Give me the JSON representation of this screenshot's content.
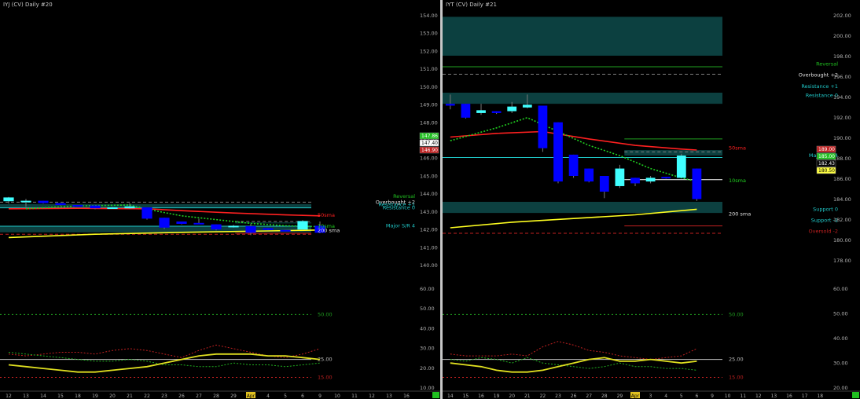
{
  "colors": {
    "background": "#000000",
    "bull_candle": "#40ffff",
    "bear_candle": "#0000ff",
    "zone_fill": "#0e4b4b",
    "sma50": "#ff2020",
    "sma10": "#20d020",
    "sma200": "#ffff20",
    "adx_red": "#c02020",
    "adx_green": "#20b020",
    "adx_yellow": "#e0e020",
    "reversal_line": "#20a020",
    "support_line": "#20c8c8",
    "price_label": "#ffd040"
  },
  "chart_data": [
    {
      "type": "candlestick",
      "id": "left",
      "title": "IYJ (CV) Daily #20",
      "ylim": [
        140.2,
        194.2
      ],
      "x_labels": [
        "12",
        "13",
        "14",
        "15",
        "18",
        "19",
        "20",
        "21",
        "22",
        "23",
        "26",
        "27",
        "28",
        "29",
        "Apr",
        "4",
        "5",
        "6",
        "9",
        "10",
        "11",
        "12",
        "13",
        "16"
      ],
      "candles": [
        {
          "o": 153.5,
          "h": 154.4,
          "l": 153.0,
          "c": 154.3
        },
        {
          "o": 153.5,
          "h": 154.0,
          "l": 152.3,
          "c": 153.6
        },
        {
          "o": 153.6,
          "h": 153.6,
          "l": 153.0,
          "c": 153.1
        },
        {
          "o": 153.1,
          "h": 153.1,
          "l": 152.6,
          "c": 152.7
        },
        {
          "o": 152.7,
          "h": 152.7,
          "l": 152.4,
          "c": 152.5
        },
        {
          "o": 152.6,
          "h": 152.6,
          "l": 151.8,
          "c": 152.0
        },
        {
          "o": 152.2,
          "h": 152.3,
          "l": 152.1,
          "c": 152.2
        },
        {
          "o": 152.0,
          "h": 153.1,
          "l": 151.9,
          "c": 152.4
        },
        {
          "o": 152.2,
          "h": 152.2,
          "l": 149.6,
          "c": 149.8
        },
        {
          "o": 150.0,
          "h": 150.0,
          "l": 147.6,
          "c": 147.9
        },
        {
          "o": 149.2,
          "h": 149.2,
          "l": 148.6,
          "c": 148.7
        },
        {
          "o": 148.9,
          "h": 149.8,
          "l": 148.7,
          "c": 148.7
        },
        {
          "o": 148.6,
          "h": 148.6,
          "l": 147.3,
          "c": 147.5
        },
        {
          "o": 148.1,
          "h": 148.5,
          "l": 147.9,
          "c": 148.3
        },
        {
          "o": 148.2,
          "h": 148.7,
          "l": 146.3,
          "c": 146.8
        },
        {
          "o": 147.8,
          "h": 147.8,
          "l": 147.3,
          "c": 147.4
        },
        {
          "o": 147.4,
          "h": 147.4,
          "l": 147.1,
          "c": 147.2
        },
        {
          "o": 147.5,
          "h": 149.5,
          "l": 147.4,
          "c": 149.3
        },
        {
          "o": 148.3,
          "h": 149.2,
          "l": 146.7,
          "c": 146.8
        }
      ],
      "sma50": [
        {
          "i": 0,
          "v": 151.9
        },
        {
          "i": 4,
          "v": 152.0
        },
        {
          "i": 8,
          "v": 151.9
        },
        {
          "i": 10,
          "v": 151.5
        },
        {
          "i": 13,
          "v": 151.0
        },
        {
          "i": 16,
          "v": 150.6
        },
        {
          "i": 18,
          "v": 150.4
        }
      ],
      "sma10": [
        {
          "i": 1,
          "v": 151.9
        },
        {
          "i": 4,
          "v": 152.5
        },
        {
          "i": 7,
          "v": 152.7
        },
        {
          "i": 8,
          "v": 151.8
        },
        {
          "i": 10,
          "v": 150.4
        },
        {
          "i": 12,
          "v": 149.6
        },
        {
          "i": 14,
          "v": 148.8
        },
        {
          "i": 16,
          "v": 148.3
        },
        {
          "i": 18,
          "v": 148.1
        }
      ],
      "sma200": [
        {
          "i": 0,
          "v": 145.8
        },
        {
          "i": 5,
          "v": 146.5
        },
        {
          "i": 10,
          "v": 146.9
        },
        {
          "i": 15,
          "v": 147.2
        },
        {
          "i": 18,
          "v": 147.4
        }
      ],
      "zones": [
        {
          "top": 152.9,
          "bottom": 152.1
        },
        {
          "top": 148.2,
          "bottom": 146.9
        },
        {
          "top": 149.0,
          "bottom": 148.8,
          "x_from": 13.1
        }
      ],
      "h_lines": [
        {
          "value": 153.3,
          "style": "dashed",
          "color": "#808080"
        },
        {
          "value": 148.2,
          "style": "solid",
          "color": "#20c8c8"
        },
        {
          "value": 149.2,
          "style": "dashed",
          "color": "#808080",
          "x_from": 13.1
        },
        {
          "value": 152.1,
          "style": "solid",
          "color": "#20c8c8"
        },
        {
          "value": 146.5,
          "style": "dashed",
          "color": "#c02020"
        },
        {
          "value": 146.7,
          "style": "solid",
          "color": "#c02020",
          "x_from": 13.1
        }
      ],
      "line_labels": [
        {
          "text": "Reversal",
          "value": 154.5,
          "color": "#20c020"
        },
        {
          "text": "Overbought +2",
          "value": 153.3,
          "color": "#e0e0e0"
        },
        {
          "text": "Resistance +1",
          "value": 152.8,
          "color": "#20c8c8"
        },
        {
          "text": "Resistance 0",
          "value": 152.1,
          "color": "#20c8c8"
        },
        {
          "text": "Major S/R 4",
          "value": 148.3,
          "color": "#20c8c8"
        }
      ],
      "ma_labels": [
        {
          "text": "50sma",
          "value": 150.5,
          "color": "#ff2020"
        },
        {
          "text": "10sma",
          "value": 148.2,
          "color": "#20d020"
        },
        {
          "text": "200 sma",
          "value": 147.3,
          "color": "#e0e0e0"
        }
      ],
      "y_ticks": [
        "154.00",
        "153.00",
        "152.00",
        "151.00",
        "150.00",
        "149.00",
        "148.00",
        "147.00",
        "146.00",
        "145.00",
        "144.00",
        "143.00",
        "142.00",
        "141.00",
        "140.00",
        "60.00",
        "50.00",
        "40.00",
        "30.00",
        "20.00",
        "10.00"
      ],
      "price_tags": [
        {
          "text": "147.86",
          "bg": "#20c020"
        },
        {
          "text": "147.40",
          "bg": "#ffffff"
        },
        {
          "text": "146.90",
          "bg": "#c02020"
        }
      ],
      "adx": {
        "ylim": [
          10,
          65
        ],
        "levels": [
          {
            "text": "50.00",
            "value": 50
          },
          {
            "text": "25.00",
            "value": 25
          },
          {
            "text": "15.00",
            "value": 15
          }
        ],
        "red": [
          28,
          27,
          28,
          29,
          29,
          28,
          30,
          31,
          30,
          28,
          26,
          30,
          33,
          31,
          29,
          27,
          26,
          28,
          31
        ],
        "green": [
          29,
          28,
          27,
          26,
          25,
          24,
          24,
          25,
          24,
          22,
          22,
          21,
          21,
          23,
          22,
          22,
          21,
          22,
          23
        ],
        "yellow": [
          22,
          21,
          20,
          19,
          18,
          18,
          19,
          20,
          21,
          23,
          25,
          27,
          28,
          28,
          28,
          27,
          27,
          26,
          25
        ]
      }
    },
    {
      "type": "candlestick",
      "id": "right",
      "title": "IYT (CV) Daily #21",
      "ylim": [
        176.8,
        203.8
      ],
      "x_labels": [
        "14",
        "15",
        "16",
        "19",
        "20",
        "21",
        "22",
        "23",
        "26",
        "27",
        "28",
        "29",
        "Apr",
        "3",
        "4",
        "5",
        "6",
        "9",
        "10",
        "11",
        "12",
        "13",
        "16",
        "17",
        "18"
      ],
      "candles": [
        {
          "o": 193.6,
          "h": 194.6,
          "l": 193.0,
          "c": 193.4
        },
        {
          "o": 193.6,
          "h": 193.6,
          "l": 192.0,
          "c": 192.1
        },
        {
          "o": 192.6,
          "h": 193.6,
          "l": 192.4,
          "c": 192.9
        },
        {
          "o": 192.8,
          "h": 192.8,
          "l": 192.5,
          "c": 192.6
        },
        {
          "o": 192.8,
          "h": 193.8,
          "l": 192.6,
          "c": 193.3
        },
        {
          "o": 193.2,
          "h": 194.6,
          "l": 193.1,
          "c": 193.5
        },
        {
          "o": 193.4,
          "h": 193.4,
          "l": 188.4,
          "c": 188.8
        },
        {
          "o": 191.6,
          "h": 191.6,
          "l": 185.0,
          "c": 185.2
        },
        {
          "o": 188.1,
          "h": 188.1,
          "l": 185.6,
          "c": 185.8
        },
        {
          "o": 186.6,
          "h": 186.6,
          "l": 185.1,
          "c": 185.2
        },
        {
          "o": 185.8,
          "h": 185.8,
          "l": 183.4,
          "c": 184.1
        },
        {
          "o": 184.7,
          "h": 187.0,
          "l": 184.5,
          "c": 186.6
        },
        {
          "o": 185.6,
          "h": 185.6,
          "l": 184.7,
          "c": 185.0
        },
        {
          "o": 185.2,
          "h": 185.8,
          "l": 185.0,
          "c": 185.6
        },
        {
          "o": 185.7,
          "h": 185.7,
          "l": 185.5,
          "c": 185.6
        },
        {
          "o": 185.6,
          "h": 188.2,
          "l": 185.6,
          "c": 188.0
        },
        {
          "o": 186.6,
          "h": 186.6,
          "l": 183.1,
          "c": 183.3
        }
      ],
      "sma50": [
        {
          "i": 0,
          "v": 190.0
        },
        {
          "i": 3,
          "v": 190.4
        },
        {
          "i": 6,
          "v": 190.6
        },
        {
          "i": 9,
          "v": 189.8
        },
        {
          "i": 12,
          "v": 189.1
        },
        {
          "i": 15,
          "v": 188.7
        },
        {
          "i": 16,
          "v": 188.6
        }
      ],
      "sma10": [
        {
          "i": 0,
          "v": 189.6
        },
        {
          "i": 3,
          "v": 191.0
        },
        {
          "i": 5,
          "v": 192.1
        },
        {
          "i": 7,
          "v": 190.6
        },
        {
          "i": 9,
          "v": 189.1
        },
        {
          "i": 11,
          "v": 188.0
        },
        {
          "i": 13,
          "v": 186.6
        },
        {
          "i": 15,
          "v": 185.6
        },
        {
          "i": 16,
          "v": 185.2
        }
      ],
      "sma200": [
        {
          "i": 0,
          "v": 180.2
        },
        {
          "i": 4,
          "v": 180.8
        },
        {
          "i": 8,
          "v": 181.2
        },
        {
          "i": 12,
          "v": 181.6
        },
        {
          "i": 16,
          "v": 182.2
        }
      ],
      "zones": [
        {
          "top": 203.0,
          "bottom": 198.8
        },
        {
          "top": 194.8,
          "bottom": 193.6
        },
        {
          "top": 188.6,
          "bottom": 188.0,
          "x_from": 11.3
        },
        {
          "top": 183.0,
          "bottom": 181.8
        }
      ],
      "h_lines": [
        {
          "value": 197.6,
          "style": "solid",
          "color": "#20a020"
        },
        {
          "value": 196.8,
          "style": "dashed",
          "color": "#808080"
        },
        {
          "value": 187.8,
          "style": "solid",
          "color": "#20c8c8"
        },
        {
          "value": 189.8,
          "style": "solid",
          "color": "#20a020",
          "x_from": 11.3
        },
        {
          "value": 188.4,
          "style": "dashed",
          "color": "#808080",
          "x_from": 11.3
        },
        {
          "value": 185.4,
          "style": "solid",
          "color": "#ffffff",
          "x_from": 11.3
        },
        {
          "value": 179.6,
          "style": "dashed",
          "color": "#c02020"
        },
        {
          "value": 180.4,
          "style": "solid",
          "color": "#c02020",
          "x_from": 11.3
        }
      ],
      "line_labels": [
        {
          "text": "Reversal",
          "value": 197.9,
          "color": "#20c020"
        },
        {
          "text": "Overbought +2",
          "value": 196.7,
          "color": "#e0e0e0"
        },
        {
          "text": "Resistance +1",
          "value": 195.5,
          "color": "#20c8c8"
        },
        {
          "text": "Resistance 0",
          "value": 194.5,
          "color": "#20c8c8"
        },
        {
          "text": "Major S/R 4",
          "value": 188.0,
          "color": "#20c8c8"
        },
        {
          "text": "Support 0",
          "value": 182.2,
          "color": "#20c8c8"
        },
        {
          "text": "Support -1",
          "value": 181.0,
          "color": "#20c8c8"
        },
        {
          "text": "Oversold -2",
          "value": 179.8,
          "color": "#c02020"
        }
      ],
      "ma_labels": [
        {
          "text": "50sma",
          "value": 188.8,
          "color": "#ff2020"
        },
        {
          "text": "10sma",
          "value": 185.3,
          "color": "#20d020"
        },
        {
          "text": "200 sma",
          "value": 181.7,
          "color": "#e0e0e0"
        }
      ],
      "y_ticks": [
        "202.00",
        "200.00",
        "198.00",
        "196.00",
        "194.00",
        "192.00",
        "190.00",
        "188.00",
        "186.00",
        "184.00",
        "182.00",
        "180.00",
        "178.00",
        "60.00",
        "50.00",
        "40.00",
        "30.00",
        "20.00"
      ],
      "price_tags": [
        {
          "text": "189.00",
          "bg": "#c02020"
        },
        {
          "text": "185.00",
          "bg": "#20c020"
        },
        {
          "text": "182.43",
          "bg": "#000000"
        },
        {
          "text": "180.50",
          "bg": "#ffff40"
        }
      ],
      "adx": {
        "ylim": [
          10,
          65
        ],
        "levels": [
          {
            "text": "50.00",
            "value": 50
          },
          {
            "text": "25.00",
            "value": 25
          },
          {
            "text": "15.00",
            "value": 15
          }
        ],
        "red": [
          28,
          27,
          27,
          27,
          28,
          27,
          32,
          35,
          33,
          30,
          29,
          27,
          26,
          25,
          26,
          27,
          31
        ],
        "green": [
          25,
          24,
          26,
          25,
          23,
          26,
          23,
          22,
          21,
          20,
          21,
          23,
          21,
          21,
          20,
          20,
          19
        ],
        "yellow": [
          23,
          22,
          21,
          19,
          18,
          18,
          19,
          21,
          23,
          25,
          26,
          24,
          24,
          25,
          24,
          23,
          24
        ]
      }
    }
  ]
}
